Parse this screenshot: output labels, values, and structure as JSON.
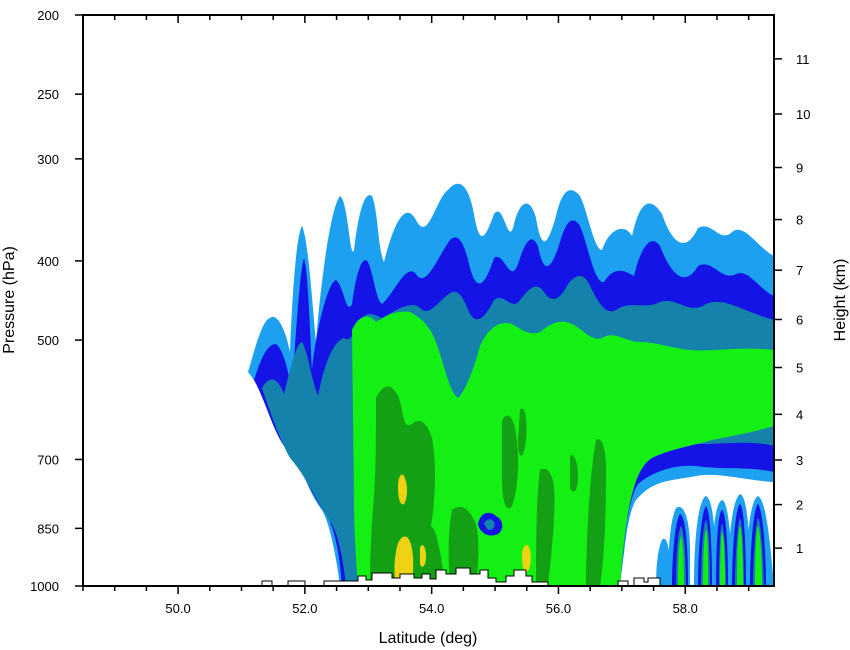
{
  "chart_data": {
    "type": "contour",
    "title": "",
    "xlabel": "Latitude (deg)",
    "ylabel": "Pressure (hPa)",
    "y2label": "Height (km)",
    "xlim": [
      48.5,
      59.4
    ],
    "ylim": [
      1000,
      200
    ],
    "yscale": "log",
    "x_ticks": [
      50.0,
      52.0,
      54.0,
      56.0,
      58.0
    ],
    "x_tick_labels": [
      "50.0",
      "52.0",
      "54.0",
      "56.0",
      "58.0"
    ],
    "y_ticks": [
      200,
      250,
      300,
      400,
      500,
      700,
      850,
      1000
    ],
    "y_tick_labels": [
      "200",
      "250",
      "300",
      "400",
      "500",
      "700",
      "850",
      "1000"
    ],
    "y2_ticks": [
      1,
      2,
      3,
      4,
      5,
      6,
      7,
      8,
      9,
      10,
      11
    ],
    "y2_tick_labels": [
      "1",
      "2",
      "3",
      "4",
      "5",
      "6",
      "7",
      "8",
      "9",
      "10",
      "11"
    ],
    "fill_levels": [
      {
        "level": 1,
        "color": "#1ea0f0"
      },
      {
        "level": 2,
        "color": "#1414e6"
      },
      {
        "level": 3,
        "color": "#1482aa"
      },
      {
        "level": 4,
        "color": "#14f014"
      },
      {
        "level": 5,
        "color": "#14a014"
      },
      {
        "level": 6,
        "color": "#f0d214"
      }
    ],
    "surface_color": "#ffffff",
    "grid": false,
    "legend": "none"
  }
}
